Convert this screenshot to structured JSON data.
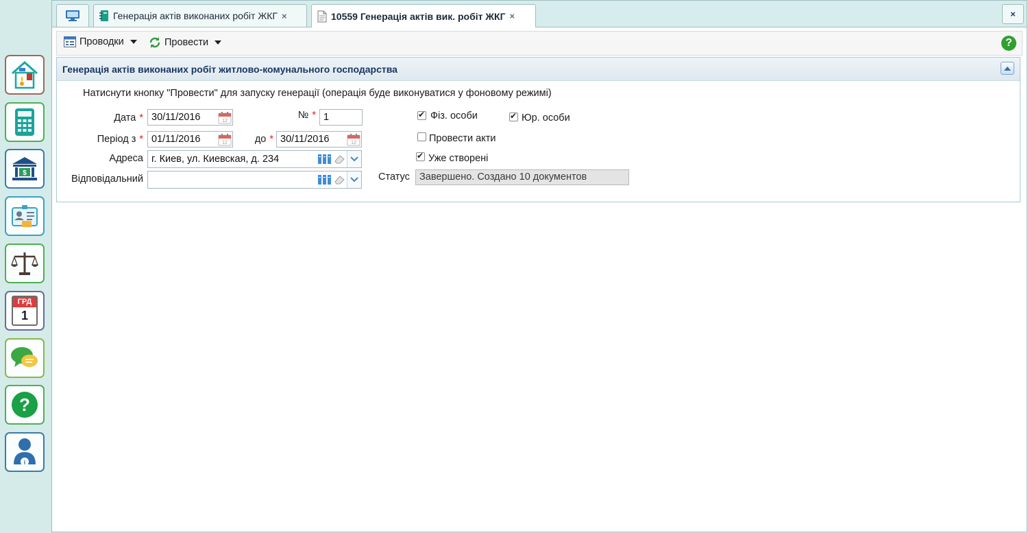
{
  "sidebar": {
    "items": [
      {
        "name": "housing-utilities-icon"
      },
      {
        "name": "calculator-icon"
      },
      {
        "name": "bank-icon"
      },
      {
        "name": "personal-card-icon"
      },
      {
        "name": "scales-icon"
      },
      {
        "name": "calendar-icon",
        "label_top": "ГРД",
        "label_day": "1"
      },
      {
        "name": "chat-icon"
      },
      {
        "name": "help-icon"
      },
      {
        "name": "user-info-icon"
      }
    ]
  },
  "tabs": [
    {
      "label": "",
      "icon": "monitor-icon"
    },
    {
      "label": "Генерація актів виконаних робіт ЖКГ",
      "icon": "notebook-icon",
      "close": "×"
    },
    {
      "label": "10559 Генерація актів вик. робіт ЖКГ",
      "icon": "document-icon",
      "close": "×",
      "active": true
    }
  ],
  "window_close": "×",
  "toolbar": {
    "postings_label": "Проводки",
    "post_label": "Провести",
    "help": "?"
  },
  "panel": {
    "title": "Генерація актів виконаних робіт житлово-комунального господарства",
    "hint": "Натиснути кнопку \"Провести\" для запуску генерації (операція буде виконуватися у фоновому режимі)",
    "date_label": "Дата",
    "date_value": "30/11/2016",
    "number_label": "№",
    "number_value": "1",
    "period_label": "Період з",
    "period_from": "01/11/2016",
    "period_to_label": "до",
    "period_to": "30/11/2016",
    "address_label": "Адреса",
    "address_value": "г. Киев, ул. Киевская, д. 234",
    "responsible_label": "Відповідальний",
    "responsible_value": "",
    "required_mark": "*",
    "individuals_label": "Фіз. особи",
    "individuals_checked": true,
    "legal_label": "Юр. особи",
    "legal_checked": true,
    "post_acts_label": "Провести акти",
    "post_acts_checked": false,
    "already_created_label": "Уже створені",
    "already_created_checked": true,
    "status_label": "Статус",
    "status_value": "Завершено. Создано 10 документов"
  },
  "colors": {
    "sidebar_bg": "#d5ebea",
    "accent_green": "#4fb04f",
    "header_text": "#1b3660",
    "required": "#e01b1b"
  }
}
